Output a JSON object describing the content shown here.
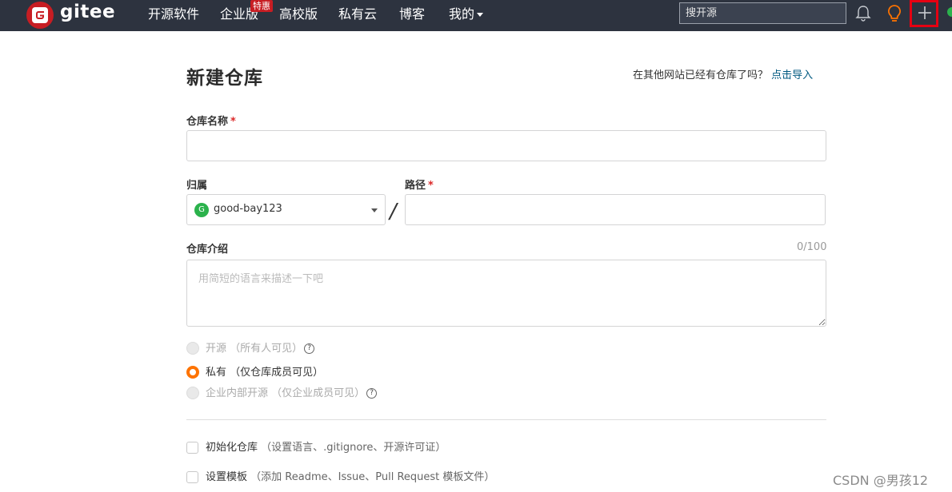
{
  "nav": {
    "logo_text": "gitee",
    "items": [
      "开源软件",
      "企业版",
      "高校版",
      "私有云",
      "博客"
    ],
    "badge": "特惠",
    "mine": "我的",
    "search_placeholder": "搜开源"
  },
  "page": {
    "title": "新建仓库",
    "import_prompt": "在其他网站已经有仓库了吗？",
    "import_link": "点击导入"
  },
  "form": {
    "repo_name_label": "仓库名称",
    "required_mark": "*",
    "owner_label": "归属",
    "owner_avatar_letter": "G",
    "owner_value": "good-bay123",
    "slash": "/",
    "path_label": "路径",
    "desc_label": "仓库介绍",
    "desc_counter": "0/100",
    "desc_placeholder": "用简短的语言来描述一下吧",
    "visibility": [
      {
        "label": "开源 （所有人可见）",
        "state": "disabled",
        "help": true
      },
      {
        "label": "私有 （仅仓库成员可见）",
        "state": "checked",
        "help": false
      },
      {
        "label": "企业内部开源 （仅企业成员可见）",
        "state": "disabled",
        "help": true
      }
    ],
    "help_glyph": "?",
    "init_repo_label": "初始化仓库",
    "init_repo_hint": "（设置语言、.gitignore、开源许可证）",
    "template_label": "设置模板",
    "template_hint": "（添加 Readme、Issue、Pull Request 模板文件）"
  },
  "watermark": "CSDN @男孩12",
  "colors": {
    "nav_bg": "#2d333f",
    "brand_red": "#c71d23",
    "radio_orange": "#fe7300",
    "link_blue": "#005980",
    "highlight_red": "#e60012"
  }
}
